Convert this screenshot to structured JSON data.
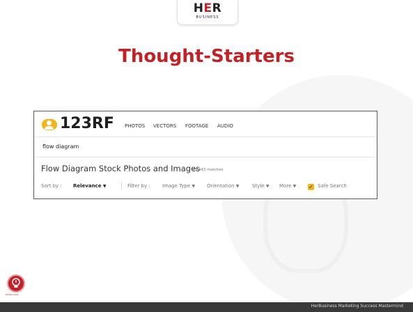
{
  "logo": {
    "her_left": "H",
    "her_mid": "E",
    "her_right": "R",
    "business": "BUSINESS"
  },
  "slide_title": "Thought-Starters",
  "screenshot": {
    "logo_text": "123RF",
    "logo_reg": "®",
    "nav": [
      "PHOTOS",
      "VECTORS",
      "FOOTAGE",
      "AUDIO"
    ],
    "search_value": "flow diagram",
    "results_title": "Flow Diagram Stock Photos and Images",
    "results_count": "45,443 matches",
    "sort_label": "Sort by :",
    "sort_value": "Relevance",
    "filter_label": "Filter by :",
    "filters": [
      "Image Type",
      "Orientation",
      "Style",
      "More"
    ],
    "safe_search": "Safe Search",
    "accent": "#f2b51a"
  },
  "bulb_caption": "HerBusiness",
  "footer_text": "HerBusiness Marketing Success Mastermind",
  "colors": {
    "brand_red": "#c42126",
    "footer": "#3a3a3a"
  }
}
